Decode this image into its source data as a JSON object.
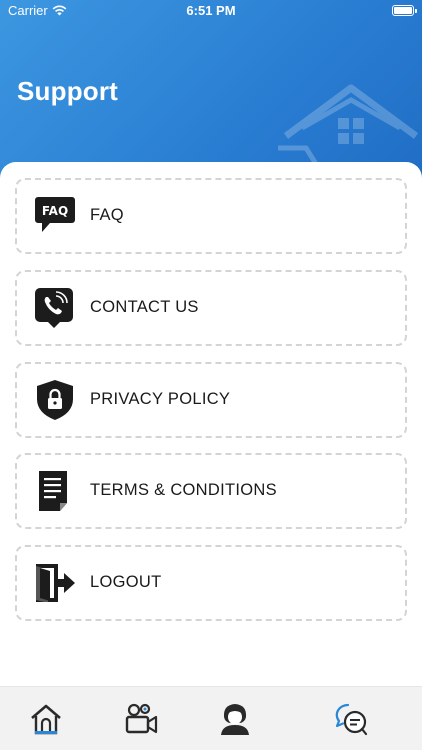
{
  "status_bar": {
    "carrier": "Carrier",
    "time": "6:51 PM"
  },
  "header": {
    "title": "Support"
  },
  "menu": [
    {
      "label": "FAQ",
      "icon": "faq-bubble-icon"
    },
    {
      "label": "CONTACT US",
      "icon": "phone-bubble-icon"
    },
    {
      "label": "PRIVACY POLICY",
      "icon": "shield-lock-icon"
    },
    {
      "label": "TERMS & CONDITIONS",
      "icon": "document-icon"
    },
    {
      "label": "LOGOUT",
      "icon": "logout-door-icon"
    }
  ],
  "tabs": [
    {
      "name": "home",
      "icon": "home-icon"
    },
    {
      "name": "video",
      "icon": "video-camera-icon"
    },
    {
      "name": "profile",
      "icon": "user-icon",
      "active": true
    },
    {
      "name": "support",
      "icon": "support-chat-icon"
    }
  ],
  "colors": {
    "header_start": "#3d97e0",
    "header_end": "#1f6cc4",
    "accent": "#2a87d8",
    "icon_dark": "#1c1c1c"
  }
}
